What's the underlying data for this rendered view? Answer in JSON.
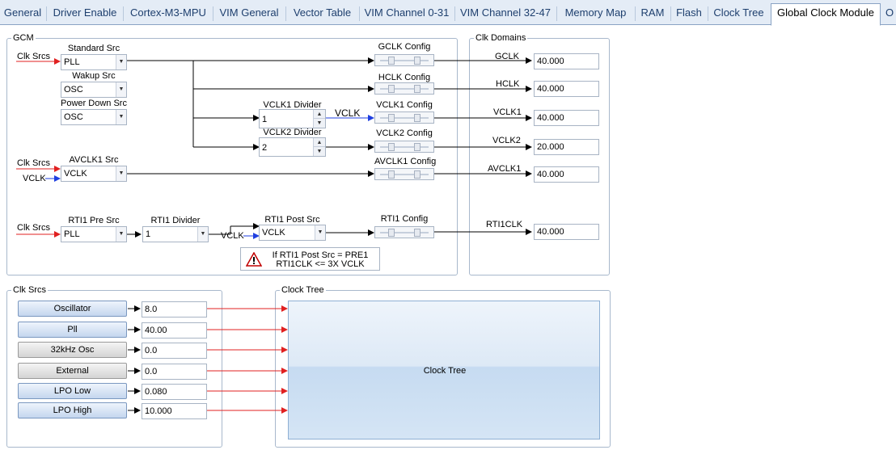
{
  "tabs": [
    {
      "label": "General"
    },
    {
      "label": "Driver Enable"
    },
    {
      "label": "Cortex-M3-MPU"
    },
    {
      "label": "VIM General"
    },
    {
      "label": "Vector Table"
    },
    {
      "label": "VIM Channel 0-31"
    },
    {
      "label": "VIM Channel 32-47"
    },
    {
      "label": "Memory Map"
    },
    {
      "label": "RAM"
    },
    {
      "label": "Flash"
    },
    {
      "label": "Clock Tree"
    },
    {
      "label": "Global Clock Module",
      "active": true
    },
    {
      "label": "O"
    }
  ],
  "gcm": {
    "title": "GCM",
    "clk_srcs_label": "Clk Srcs",
    "vclk_label": "VCLK",
    "standard_src": {
      "label": "Standard Src",
      "value": "PLL"
    },
    "wakeup_src": {
      "label": "Wakup Src",
      "value": "OSC"
    },
    "powerdown_src": {
      "label": "Power Down Src",
      "value": "OSC"
    },
    "vclk1_divider": {
      "label": "VCLK1 Divider",
      "value": "1"
    },
    "vclk2_divider": {
      "label": "VCLK2 Divider",
      "value": "2"
    },
    "vclk1_wire_label": "VCLK",
    "avclk1_src": {
      "label": "AVCLK1 Src",
      "value": "VCLK"
    },
    "rti1_pre_src": {
      "label": "RTI1 Pre Src",
      "value": "PLL"
    },
    "rti1_divider": {
      "label": "RTI1 Divider",
      "value": "1"
    },
    "rti1_post_src": {
      "label": "RTI1 Post Src",
      "value": "VCLK"
    },
    "configs": [
      "GCLK Config",
      "HCLK Config",
      "VCLK1 Config",
      "VCLK2 Config",
      "AVCLK1 Config",
      "RTI1 Config"
    ],
    "warning_line1": "If RTI1 Post Src = PRE1",
    "warning_line2": "RTI1CLK <= 3X VCLK"
  },
  "clk_domains": {
    "title": "Clk Domains",
    "items": [
      {
        "label": "GCLK",
        "value": "40.000"
      },
      {
        "label": "HCLK",
        "value": "40.000"
      },
      {
        "label": "VCLK1",
        "value": "40.000"
      },
      {
        "label": "VCLK2",
        "value": "20.000"
      },
      {
        "label": "AVCLK1",
        "value": "40.000"
      },
      {
        "label": "RTI1CLK",
        "value": "40.000"
      }
    ]
  },
  "clk_srcs_panel": {
    "title": "Clk Srcs",
    "items": [
      {
        "label": "Oscillator",
        "value": "8.0",
        "style": "blue"
      },
      {
        "label": "Pll",
        "value": "40.00",
        "style": "blue"
      },
      {
        "label": "32kHz Osc",
        "value": "0.0",
        "style": "gray"
      },
      {
        "label": "External",
        "value": "0.0",
        "style": "gray"
      },
      {
        "label": "LPO Low",
        "value": "0.080",
        "style": "blue"
      },
      {
        "label": "LPO High",
        "value": "10.000",
        "style": "blue"
      }
    ]
  },
  "clock_tree_panel": {
    "title": "Clock Tree",
    "button_label": "Clock Tree"
  },
  "colors": {
    "accent_red": "#e02020",
    "accent_blue": "#1f3fe0",
    "tab_text": "#1e3f6e"
  }
}
